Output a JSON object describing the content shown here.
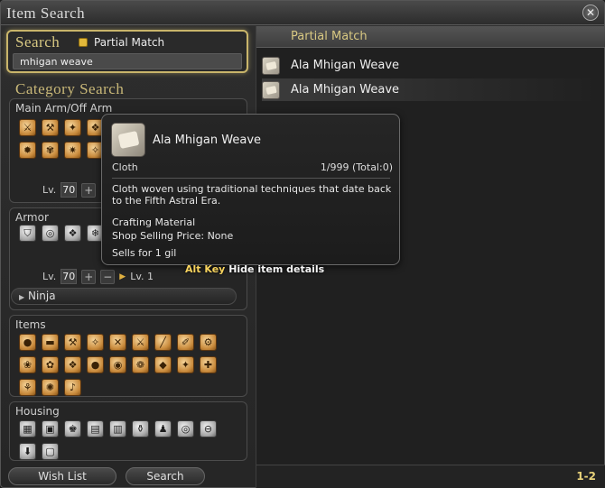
{
  "window": {
    "title": "Item Search",
    "close_glyph": "✕"
  },
  "search": {
    "heading": "Search",
    "partial_match_label": "Partial Match",
    "input_value": "mhigan weave"
  },
  "category": {
    "heading": "Category Search",
    "main_arm": {
      "title": "Main Arm/Off Arm",
      "level_label": "Lv.",
      "level_value": "70",
      "plus": "+"
    },
    "armor": {
      "title": "Armor",
      "level_label": "Lv.",
      "level_value": "70",
      "plus": "+",
      "minus": "−",
      "level_arrow": "▶",
      "level_upper": "Lv. 1",
      "job_selected": "Ninja",
      "job_arrow": "▶"
    },
    "items": {
      "title": "Items"
    },
    "housing": {
      "title": "Housing"
    }
  },
  "buttons": {
    "wish_list": "Wish List",
    "search": "Search"
  },
  "results": {
    "header": "Partial Match",
    "list": [
      {
        "name": "Ala Mhigan Weave"
      },
      {
        "name": "Ala Mhigan Weave"
      }
    ],
    "page": "1-2"
  },
  "tooltip": {
    "name": "Ala Mhigan Weave",
    "category": "Cloth",
    "count": "1/999 (Total:0)",
    "description": "Cloth woven using traditional techniques that date back to the Fifth Astral Era.",
    "type": "Crafting Material",
    "shop_price": "Shop Selling Price: None",
    "sells_for": "Sells for 1 gil",
    "hint_key": "Alt Key",
    "hint_action": "Hide item details"
  },
  "icons": {
    "main_arm_gold": [
      "⚔",
      "⚒",
      "✦",
      "❖",
      "⚕",
      "✥",
      "✺",
      "✶",
      "❂",
      "✹",
      "✾",
      "✷",
      "✧"
    ],
    "armor_silver": [
      "⛉",
      "◎",
      "❖",
      "❄",
      "✿",
      "❂",
      "✦",
      "✺"
    ],
    "items_gold": [
      "●",
      "▬",
      "⚒",
      "✧",
      "✕",
      "⚔",
      "╱",
      "✐",
      "⚙",
      "❀",
      "✿",
      "❖",
      "●",
      "◉",
      "❁",
      "◆",
      "✦",
      "✚",
      "⚘",
      "✺",
      "♪"
    ],
    "housing_silver": [
      "▦",
      "▣",
      "♚",
      "▤",
      "▥",
      "⚱",
      "♟",
      "◎",
      "⊖",
      "⬇",
      "▢"
    ]
  },
  "colors": {
    "accent_gold": "#d8c882",
    "selection_border": "#c9b56a",
    "hint_key": "#f7d35e"
  }
}
